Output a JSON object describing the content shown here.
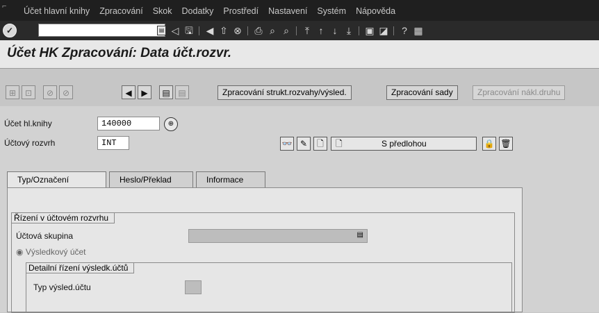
{
  "menubar": {
    "items": [
      "Účet hlavní knihy",
      "Zpracování",
      "Skok",
      "Dodatky",
      "Prostředí",
      "Nastavení",
      "Systém",
      "Nápověda"
    ]
  },
  "systoolbar": {
    "command_value": "",
    "icons": [
      "back",
      "save",
      "nav-back",
      "exit",
      "cancel",
      "print",
      "find",
      "find-next",
      "first-page",
      "prev-page",
      "next-page",
      "last-page",
      "new-session",
      "shortcut",
      "help",
      "layout"
    ]
  },
  "title": "Účet HK Zpracování: Data účt.rozvr.",
  "apptoolbar": {
    "buttons": [
      "Zpracování strukt.rozvahy/výsled.",
      "Zpracování sady",
      "Zpracování nákl.druhu"
    ]
  },
  "header_fields": {
    "account_label": "Účet hl.knihy",
    "account_value": "140000",
    "chart_label": "Účtový rozvrh",
    "chart_value": "INT",
    "template_button": "S předlohou"
  },
  "tabs": [
    "Typ/Označení",
    "Heslo/Překlad",
    "Informace"
  ],
  "panel": {
    "group_title": "Řízení v účtovém rozvrhu",
    "account_group_label": "Účtová skupina",
    "account_group_value": "",
    "radio_label": "Výsledkový účet",
    "subgroup_title": "Detailní řízení výsledk.účtů",
    "result_type_label": "Typ výsled.účtu",
    "result_type_value": ""
  }
}
